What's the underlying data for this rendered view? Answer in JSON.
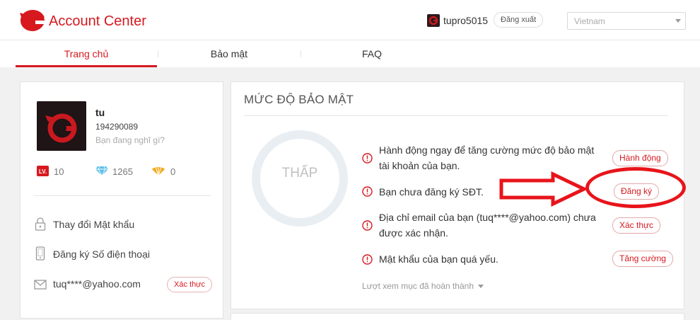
{
  "header": {
    "title": "Account Center",
    "username": "tupro5015",
    "logout_label": "Đăng xuất",
    "region_selected": "Vietnam"
  },
  "tabs": [
    {
      "label": "Trang chủ",
      "active": true
    },
    {
      "label": "Bảo mật",
      "active": false
    },
    {
      "label": "FAQ",
      "active": false
    }
  ],
  "profile": {
    "name": "tu",
    "id": "194290089",
    "status_placeholder": "Bạn đang nghĩ gì?",
    "stats": {
      "level": "10",
      "diamonds": "1265",
      "shells": "0"
    }
  },
  "account_menu": [
    {
      "label": "Thay đổi Mật khẩu",
      "icon": "lock-icon"
    },
    {
      "label": "Đăng ký Số điện thoại",
      "icon": "phone-icon"
    },
    {
      "label": "tuq****@yahoo.com",
      "icon": "mail-icon",
      "badge": "Xác thực"
    }
  ],
  "security": {
    "title": "MỨC ĐỘ BẢO MẬT",
    "level": "THẤP",
    "items": [
      {
        "text": "Hành động ngay để tăng cường mức độ bảo mật tài khoản của bạn.",
        "action": "Hành động"
      },
      {
        "text": "Bạn chưa đăng ký SĐT.",
        "action": "Đăng ký"
      },
      {
        "text": "Địa chỉ email của bạn (tuq****@yahoo.com) chưa được xác nhận.",
        "action": "Xác thực"
      },
      {
        "text": "Mật khẩu của bạn quá yếu.",
        "action": "Tăng cường"
      }
    ],
    "show_completed": "Lượt xem mục đã hoàn thành"
  },
  "colors": {
    "brand": "#d7191f",
    "annotation": "#e8141b"
  }
}
